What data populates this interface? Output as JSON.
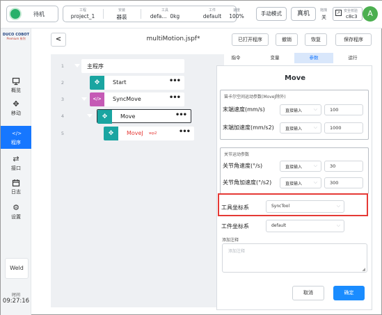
{
  "topbar": {
    "status": "待机",
    "project": {
      "label": "工程",
      "value": "project_1"
    },
    "install": {
      "label": "安装",
      "value": "器装"
    },
    "tool": {
      "label": "工具",
      "value": "defa...  0kg"
    },
    "workpiece": {
      "label": "工件",
      "value": "default"
    },
    "speed": {
      "label": "速度",
      "value": "100%"
    },
    "mode_button": "手动模式",
    "real_button": "真机",
    "drag": {
      "label": "拖拽",
      "value": "关"
    },
    "safety": {
      "label": "安全校验",
      "value": "c8c3"
    },
    "avatar": "A"
  },
  "sidebar": {
    "logo_main": "DUCO COBOT",
    "logo_sub": "Premium 系列",
    "items": [
      {
        "label": "概览",
        "icon": "monitor-icon"
      },
      {
        "label": "移动",
        "icon": "move-icon"
      },
      {
        "label": "程序",
        "icon": "code-icon"
      },
      {
        "label": "接口",
        "icon": "interface-icon"
      },
      {
        "label": "日志",
        "icon": "calendar-icon"
      },
      {
        "label": "设置",
        "icon": "gear-icon"
      }
    ],
    "weld": "Weld",
    "time_label": "时间",
    "time_value": "09:27:16"
  },
  "editor": {
    "back": "<",
    "title": "multiMotion.jspf*",
    "actions": [
      "已打开程序",
      "撤销",
      "恢复",
      "保存程序"
    ]
  },
  "tree": {
    "lines": [
      {
        "num": "1",
        "name": "主程序"
      },
      {
        "num": "2",
        "name": "Start"
      },
      {
        "num": "3",
        "name": "SyncMove"
      },
      {
        "num": "4",
        "name": "Move"
      },
      {
        "num": "5",
        "name": "MoveJ",
        "suffix": "wp2"
      }
    ],
    "more": "•••"
  },
  "tabs": [
    "指令",
    "变量",
    "参数",
    "运行"
  ],
  "props": {
    "title": "Move",
    "cart_group": {
      "caption": "笛卡尔空间运动参数(MoveJ除外)",
      "rows": [
        {
          "label": "末端速度(mm/s)",
          "mode": "直接输入",
          "value": "100"
        },
        {
          "label": "末端加速度(mm/s2)",
          "mode": "直接输入",
          "value": "1000"
        }
      ]
    },
    "joint_group": {
      "caption": "关节运动参数",
      "rows": [
        {
          "label": "关节角速度(°/s)",
          "mode": "直接输入",
          "value": "30"
        },
        {
          "label": "关节角加速度(°/s2)",
          "mode": "直接输入",
          "value": "300"
        }
      ]
    },
    "tool_frame": {
      "label": "工具坐标系",
      "value": "SyncTool"
    },
    "work_frame": {
      "label": "工件坐标系",
      "value": "default"
    },
    "note_label": "添加注释",
    "note_placeholder": "添加注释",
    "cancel": "取消",
    "ok": "确定"
  },
  "colors": {
    "accent": "#1677ff",
    "status_green": "#27b06a",
    "teal_badge": "#1aa5a1",
    "pink_badge": "#c55ab5",
    "highlight": "#e53935"
  }
}
